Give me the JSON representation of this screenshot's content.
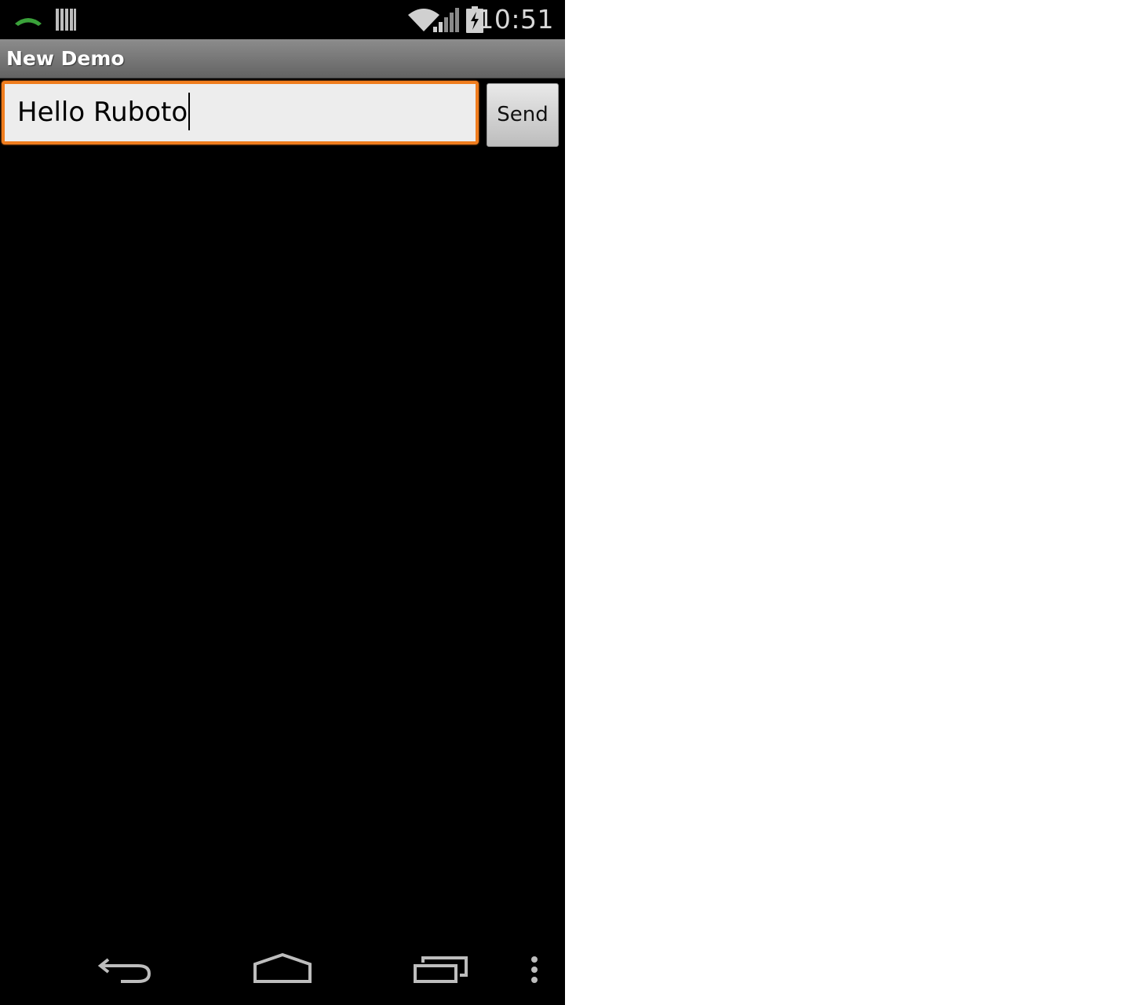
{
  "status_bar": {
    "time": "10:51",
    "icons": [
      "call-icon",
      "barcode-icon",
      "wifi-icon",
      "signal-icon",
      "battery-charging-icon"
    ]
  },
  "action_bar": {
    "title": "New Demo"
  },
  "message_input": {
    "value": "Hello Ruboto",
    "focus_color": "#f07d1e"
  },
  "send_button": {
    "label": "Send"
  },
  "nav_bar": {
    "icons": [
      "back-icon",
      "home-icon",
      "recents-icon",
      "overflow-menu-icon"
    ]
  }
}
